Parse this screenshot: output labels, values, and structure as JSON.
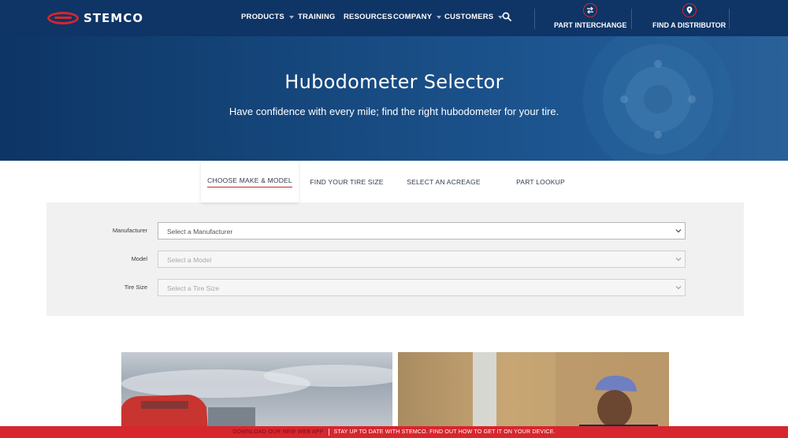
{
  "header": {
    "logo_text": "STEMCO",
    "nav": [
      {
        "label": "PRODUCTS",
        "has_caret": true
      },
      {
        "label": "TRAINING",
        "has_caret": false
      },
      {
        "label": "RESOURCES",
        "has_caret": false
      },
      {
        "label": "COMPANY",
        "has_caret": true
      },
      {
        "label": "CUSTOMERS",
        "has_caret": true
      }
    ],
    "search_icon": "search-icon",
    "part_interchange_label": "PART INTERCHANGE",
    "find_distributor_label": "FIND A DISTRIBUTOR",
    "brand_color": "#0f3466",
    "accent_color": "#d6262c"
  },
  "hero": {
    "title": "Hubodometer Selector",
    "subtitle": "Have confidence with every mile; find the right hubodometer for your tire."
  },
  "tabs": [
    {
      "label": "CHOOSE MAKE & MODEL",
      "active": true
    },
    {
      "label": "FIND YOUR TIRE SIZE",
      "active": false
    },
    {
      "label": "SELECT AN ACREAGE",
      "active": false
    },
    {
      "label": "PART LOOKUP",
      "active": false
    }
  ],
  "form": {
    "manufacturer_label": "Manufacturer",
    "manufacturer_value": "Select a Manufacturer",
    "model_label": "Model",
    "model_value": "Select a Model",
    "tire_size_label": "Tire Size",
    "tire_size_value": "Select a Tire Size"
  },
  "banner": {
    "link_text": "DOWNLOAD OUR NEW WEB APP",
    "message": "STAY UP TO DATE WITH STEMCO. FIND OUT HOW TO GET IT ON YOUR DEVICE."
  }
}
